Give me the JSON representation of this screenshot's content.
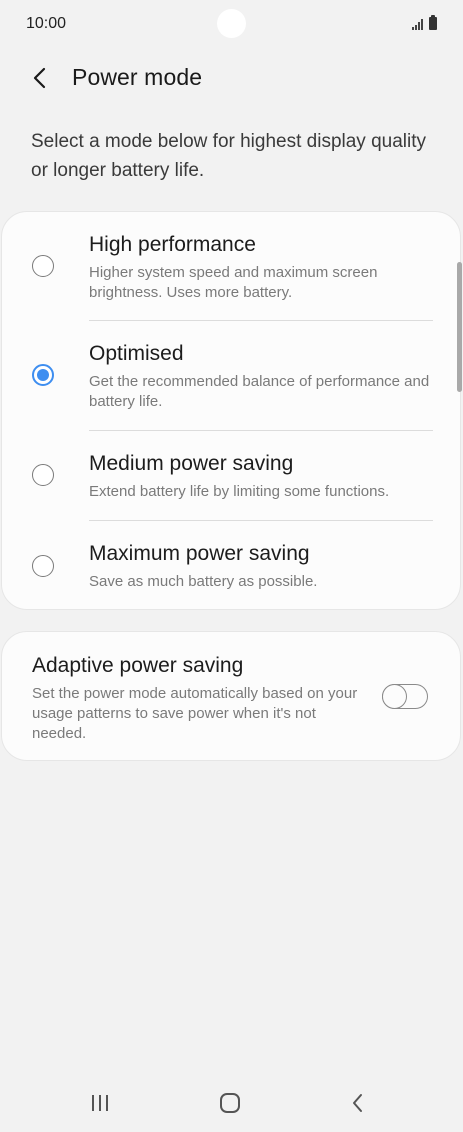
{
  "status_bar": {
    "time": "10:00",
    "signal_icon": "signal-icon",
    "battery_icon": "battery-icon"
  },
  "header": {
    "back_icon": "chevron-left-icon",
    "title": "Power mode"
  },
  "description": "Select a mode below for highest display quality or longer battery life.",
  "modes": [
    {
      "title": "High performance",
      "subtitle": "Higher system speed and maximum screen brightness. Uses more battery.",
      "selected": false
    },
    {
      "title": "Optimised",
      "subtitle": "Get the recommended balance of performance and battery life.",
      "selected": true
    },
    {
      "title": "Medium power saving",
      "subtitle": "Extend battery life by limiting some functions.",
      "selected": false
    },
    {
      "title": "Maximum power saving",
      "subtitle": "Save as much battery as possible.",
      "selected": false
    }
  ],
  "adaptive": {
    "title": "Adaptive power saving",
    "subtitle": "Set the power mode automatically based on your usage patterns to save power when it's not needed.",
    "enabled": false
  },
  "nav_bar": {
    "recents_icon": "recents-icon",
    "home_icon": "home-icon",
    "back_icon": "back-icon"
  },
  "colors": {
    "accent": "#3e8ef0",
    "background": "#f2f2f2",
    "card": "#fcfcfc"
  }
}
